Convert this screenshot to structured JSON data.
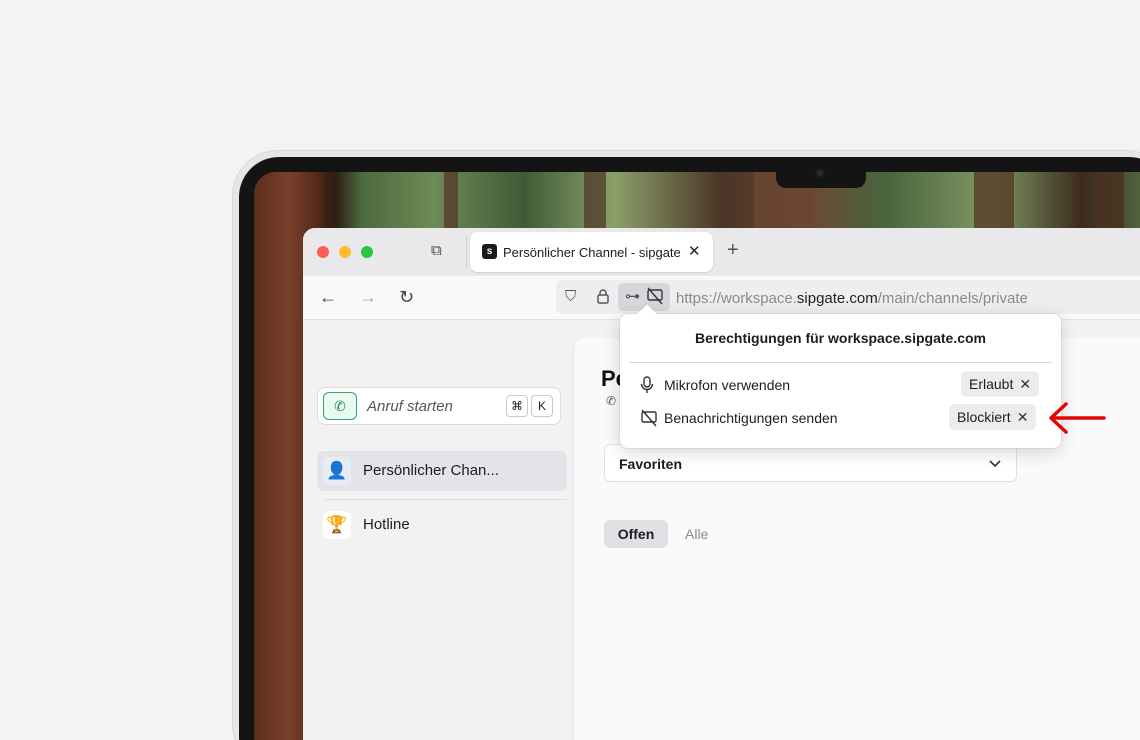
{
  "browser": {
    "tab": {
      "title": "Persönlicher Channel - sipgate",
      "favicon": "sipgate-logo"
    },
    "new_tab_label": "+",
    "url": {
      "prefix": "https://workspace.",
      "domain": "sipgate.com",
      "path": "/main/channels/private"
    }
  },
  "icons": {
    "back": "←",
    "forward": "→",
    "reload": "↻",
    "shield": "⛉",
    "lock": "🔒",
    "permissions": "⊶",
    "notif_blocked": "⊘",
    "mic": "🎙",
    "close": "✕",
    "chevron_down": "⌄",
    "phone": "✆",
    "tab_overview": "⧉"
  },
  "sidebar": {
    "call_placeholder": "Anruf starten",
    "shortcut_keys": [
      "⌘",
      "K"
    ],
    "items": [
      {
        "label": "Persönlicher Chan...",
        "icon": "person-avatar",
        "emoji": "👤",
        "active": true
      },
      {
        "label": "Hotline",
        "icon": "trophy-icon",
        "emoji": "🏆",
        "active": false
      }
    ]
  },
  "main": {
    "title": "Pe",
    "select": {
      "value": "Favoriten"
    },
    "segments": {
      "open": "Offen",
      "all": "Alle"
    }
  },
  "popover": {
    "title": "Berechtigungen für workspace.sipgate.com",
    "permissions": [
      {
        "label": "Mikrofon verwenden",
        "state": "Erlaubt",
        "icon": "microphone-icon"
      },
      {
        "label": "Benachrichtigungen senden",
        "state": "Blockiert",
        "icon": "notifications-blocked-icon"
      }
    ]
  },
  "colors": {
    "annotation_arrow": "#e10600",
    "accent_green": "#2fa56b",
    "traffic_red": "#ff5f57",
    "traffic_yellow": "#febc2e",
    "traffic_green": "#28c840"
  }
}
